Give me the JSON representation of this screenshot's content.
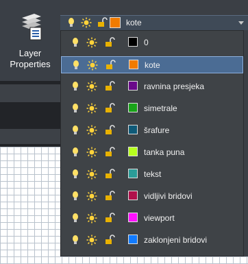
{
  "ribbon": {
    "layer_properties": {
      "line1": "Layer",
      "line2": "Properties"
    }
  },
  "current_layer": {
    "name": "kote",
    "color": "#f07b00"
  },
  "layers": [
    {
      "name": "0",
      "color": "#000000",
      "selected": false
    },
    {
      "name": "kote",
      "color": "#f07b00",
      "selected": true
    },
    {
      "name": "ravnina presjeka",
      "color": "#6a0a8a",
      "selected": false
    },
    {
      "name": "simetrale",
      "color": "#19a319",
      "selected": false
    },
    {
      "name": "šrafure",
      "color": "#0f5a78",
      "selected": false
    },
    {
      "name": "tanka puna",
      "color": "#b7ff1e",
      "selected": false
    },
    {
      "name": "tekst",
      "color": "#2b9c98",
      "selected": false
    },
    {
      "name": "vidljivi bridovi",
      "color": "#b0104b",
      "selected": false
    },
    {
      "name": "viewport",
      "color": "#ff10ff",
      "selected": false
    },
    {
      "name": "zaklonjeni bridovi",
      "color": "#117bff",
      "selected": false
    }
  ],
  "icons": [
    "lightbulb-icon",
    "sun-icon",
    "unlock-icon"
  ]
}
